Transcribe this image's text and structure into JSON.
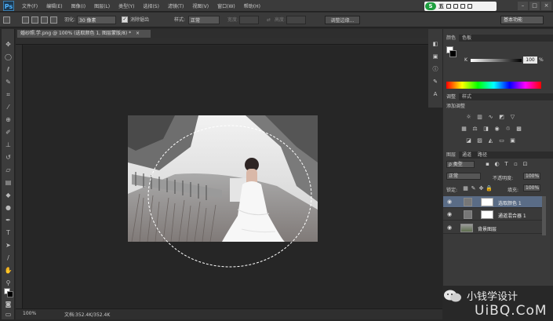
{
  "app": {
    "logo": "Ps"
  },
  "menu": [
    "文件(F)",
    "编辑(E)",
    "图像(I)",
    "图层(L)",
    "类型(Y)",
    "选择(S)",
    "滤镜(T)",
    "视图(V)",
    "窗口(W)",
    "帮助(H)"
  ],
  "options": {
    "feather_label": "羽化:",
    "feather_value": "30 像素",
    "antialias_label": "消除锯齿",
    "style_label": "样式:",
    "style_value": "正常",
    "width_label": "宽度:",
    "height_label": "高度:",
    "refine_button": "调整边缘..."
  },
  "ime": {
    "logo": "S",
    "label": "五"
  },
  "workspace": "基本功能",
  "document": {
    "tab_title": "婚纱照.学.png @ 100% (选取颜色 1, 图层蒙版/8) *",
    "close": "×"
  },
  "status": {
    "zoom": "100%",
    "doc_size": "文档:352.4K/352.4K"
  },
  "panels": {
    "color_tabs": [
      "颜色",
      "色板"
    ],
    "k_label": "K",
    "k_value": "100",
    "k_unit": "%",
    "adjust_tabs": [
      "调整",
      "样式"
    ],
    "adjust_title": "添加调整",
    "layer_tabs": [
      "图层",
      "通道",
      "路径"
    ],
    "kind_filter": "ρ 类型",
    "blend_mode": "正常",
    "opacity_label": "不透明度:",
    "opacity_value": "100%",
    "lock_label": "锁定:",
    "fill_label": "填充:",
    "fill_value": "100%",
    "layers": [
      {
        "name": "选取颜色 1",
        "selected": true
      },
      {
        "name": "通道混合器 1",
        "selected": false
      },
      {
        "name": "背景图层",
        "selected": false
      }
    ]
  },
  "watermark": {
    "name": "小钱学设计",
    "site": "UiBQ.CoM"
  },
  "colors": {
    "accent": "#5a6c86",
    "ime_green": "#1d9e3e"
  }
}
